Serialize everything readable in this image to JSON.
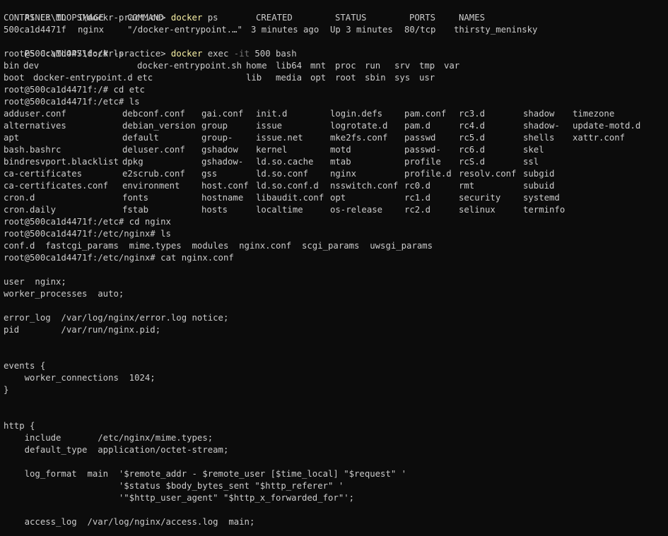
{
  "terminal": {
    "colors": {
      "background": "#0c0c0c",
      "foreground": "#cccccc",
      "command_highlight": "#f9f1a5",
      "flag": "#767676"
    },
    "ps_prompt_1": "PS C:\\MLOPS\\dockr-practice> ",
    "ps_cmd_1": "docker",
    "ps_args_1": " ps",
    "ps_header": [
      "CONTAINER ID",
      "IMAGE",
      "COMMAND",
      "CREATED",
      "STATUS",
      "PORTS",
      "NAMES"
    ],
    "ps_row": [
      "500ca1d4471f",
      "nginx",
      "\"/docker-entrypoint.…\"",
      "3 minutes ago",
      "Up 3 minutes",
      "80/tcp",
      "thirsty_meninsky"
    ],
    "ps_prompt_2": "PS C:\\MLOPS\\dockr-practice> ",
    "ps_cmd_2": "docker",
    "ps_args_2a": " exec ",
    "ps_flag_2": "-it",
    "ps_args_2b": " 500 bash",
    "root_ls_cmd": "root@500ca1d4471f:/# ls",
    "root_ls_rows": [
      [
        "bin",
        "dev",
        "docker-entrypoint.sh",
        "home",
        "lib64",
        "mnt",
        "proc",
        "run",
        "srv",
        "tmp",
        "var"
      ],
      [
        "boot",
        "docker-entrypoint.d",
        "etc",
        "lib",
        "media",
        "opt",
        "root",
        "sbin",
        "sys",
        "usr"
      ]
    ],
    "cd_etc_cmd": "root@500ca1d4471f:/# cd etc",
    "etc_ls_cmd": "root@500ca1d4471f:/etc# ls",
    "etc_ls_rows": [
      [
        "adduser.conf",
        "debconf.conf",
        "gai.conf",
        "init.d",
        "login.defs",
        "pam.conf",
        "rc3.d",
        "shadow",
        "timezone"
      ],
      [
        "alternatives",
        "debian_version",
        "group",
        "issue",
        "logrotate.d",
        "pam.d",
        "rc4.d",
        "shadow-",
        "update-motd.d"
      ],
      [
        "apt",
        "default",
        "group-",
        "issue.net",
        "mke2fs.conf",
        "passwd",
        "rc5.d",
        "shells",
        "xattr.conf"
      ],
      [
        "bash.bashrc",
        "deluser.conf",
        "gshadow",
        "kernel",
        "motd",
        "passwd-",
        "rc6.d",
        "skel",
        ""
      ],
      [
        "bindresvport.blacklist",
        "dpkg",
        "gshadow-",
        "ld.so.cache",
        "mtab",
        "profile",
        "rcS.d",
        "ssl",
        ""
      ],
      [
        "ca-certificates",
        "e2scrub.conf",
        "gss",
        "ld.so.conf",
        "nginx",
        "profile.d",
        "resolv.conf",
        "subgid",
        ""
      ],
      [
        "ca-certificates.conf",
        "environment",
        "host.conf",
        "ld.so.conf.d",
        "nsswitch.conf",
        "rc0.d",
        "rmt",
        "subuid",
        ""
      ],
      [
        "cron.d",
        "fonts",
        "hostname",
        "libaudit.conf",
        "opt",
        "rc1.d",
        "security",
        "systemd",
        ""
      ],
      [
        "cron.daily",
        "fstab",
        "hosts",
        "localtime",
        "os-release",
        "rc2.d",
        "selinux",
        "terminfo",
        ""
      ]
    ],
    "cd_nginx_cmd": "root@500ca1d4471f:/etc# cd nginx",
    "nginx_ls_cmd": "root@500ca1d4471f:/etc/nginx# ls",
    "nginx_ls": "conf.d  fastcgi_params  mime.types  modules  nginx.conf  scgi_params  uwsgi_params",
    "cat_cmd": "root@500ca1d4471f:/etc/nginx# cat nginx.conf",
    "conf_lines": [
      "",
      "user  nginx;",
      "worker_processes  auto;",
      "",
      "error_log  /var/log/nginx/error.log notice;",
      "pid        /var/run/nginx.pid;",
      "",
      "",
      "events {",
      "    worker_connections  1024;",
      "}",
      "",
      "",
      "http {",
      "    include       /etc/nginx/mime.types;",
      "    default_type  application/octet-stream;",
      "",
      "    log_format  main  '$remote_addr - $remote_user [$time_local] \"$request\" '",
      "                      '$status $body_bytes_sent \"$http_referer\" '",
      "                      '\"$http_user_agent\" \"$http_x_forwarded_for\"';",
      "",
      "    access_log  /var/log/nginx/access.log  main;"
    ]
  }
}
